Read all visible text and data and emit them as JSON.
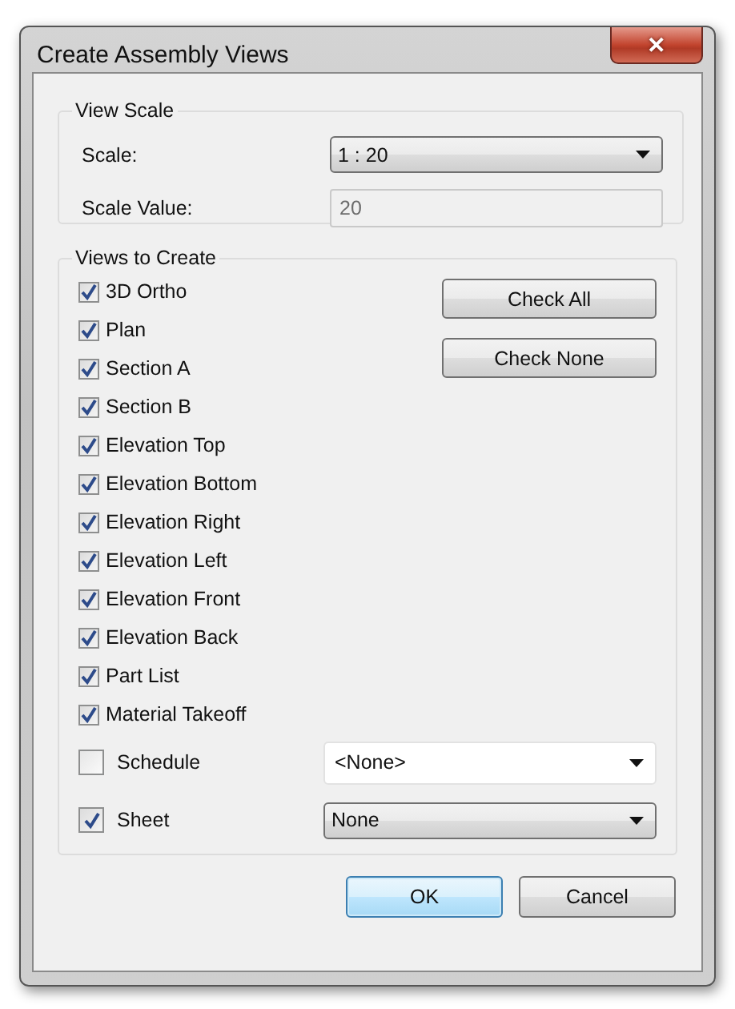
{
  "window": {
    "title": "Create Assembly Views",
    "close": "✕"
  },
  "view_scale": {
    "legend": "View Scale",
    "scale_label": "Scale:",
    "scale_value": "1 : 20",
    "value_label": "Scale Value:",
    "value_field": {
      "value": "20",
      "disabled": true
    }
  },
  "views": {
    "legend": "Views to Create",
    "items": [
      {
        "label": "3D Ortho",
        "checked": true
      },
      {
        "label": "Plan",
        "checked": true
      },
      {
        "label": "Section A",
        "checked": true
      },
      {
        "label": "Section B",
        "checked": true
      },
      {
        "label": "Elevation Top",
        "checked": true
      },
      {
        "label": "Elevation Bottom",
        "checked": true
      },
      {
        "label": "Elevation Right",
        "checked": true
      },
      {
        "label": "Elevation Left",
        "checked": true
      },
      {
        "label": "Elevation Front",
        "checked": true
      },
      {
        "label": "Elevation Back",
        "checked": true
      },
      {
        "label": "Part List",
        "checked": true
      },
      {
        "label": "Material Takeoff",
        "checked": true
      }
    ],
    "side_buttons": [
      "Check All",
      "Check None"
    ],
    "template_rows": [
      {
        "label": "Schedule",
        "checked": false,
        "dropdown": {
          "kind": "editable",
          "value": "<None>"
        }
      },
      {
        "label": "Sheet",
        "checked": true,
        "dropdown": {
          "kind": "plain",
          "value": "None"
        }
      }
    ]
  },
  "buttons": [
    {
      "label": "OK",
      "default": true
    },
    {
      "label": "Cancel",
      "default": false
    }
  ]
}
